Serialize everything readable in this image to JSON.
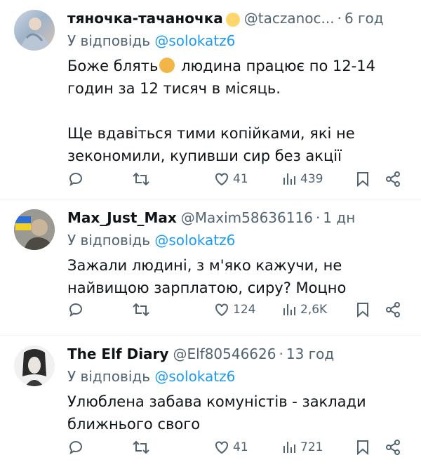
{
  "replying_label": "У відповідь",
  "tweets": [
    {
      "name": "тяночка-тачаночка",
      "handle": "@taczanoc...",
      "time": "6 год",
      "reply_to": "@solokatz6",
      "text_before_emoji": "Боже блять",
      "text_after_emoji": " людина працює по 12-14 годин за 12 тисяч в місяць.\n\nЩе вдавіться тими копійками, які не зекономили, купивши сир без акції",
      "likes": "41",
      "views": "439"
    },
    {
      "name": "Max_Just_Max",
      "handle": "@Maxim58636116",
      "time": "1 дн",
      "reply_to": "@solokatz6",
      "text": "Зажали людині, з м'яко кажучи, не найвищою зарплатою, сиру? Моцно",
      "likes": "124",
      "views": "2,6K"
    },
    {
      "name": "The Elf Diary",
      "handle": "@Elf80546626",
      "time": "13 год",
      "reply_to": "@solokatz6",
      "text": "Улюблена забава комуністів - заклади ближнього свого",
      "likes": "41",
      "views": "721"
    }
  ],
  "icons": [
    "reply-icon",
    "retweet-icon",
    "like-icon",
    "views-icon",
    "bookmark-icon",
    "share-icon"
  ],
  "colors": {
    "mention": "#1d9bf0",
    "secondary": "#536471",
    "text": "#0f1419"
  }
}
